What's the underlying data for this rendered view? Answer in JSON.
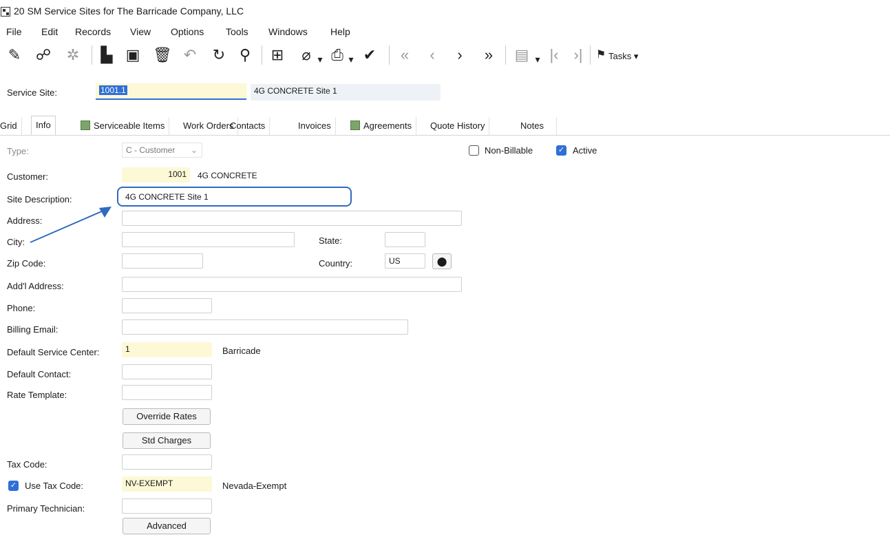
{
  "window": {
    "title": "20 SM Service Sites for The Barricade Company, LLC"
  },
  "menu": [
    "File",
    "Edit",
    "Records",
    "View",
    "Options",
    "Tools",
    "Windows",
    "Help"
  ],
  "toolbar": {
    "tasks_label": "Tasks ▾"
  },
  "header": {
    "service_site_label": "Service Site:",
    "service_site_value": "1001.1",
    "service_site_desc": "4G CONCRETE Site 1"
  },
  "tabs": [
    "Grid",
    "Info",
    "Serviceable Items",
    "Work Orders",
    "Contacts",
    "Invoices",
    "Agreements",
    "Quote History",
    "Notes"
  ],
  "form": {
    "type_label": "Type:",
    "type_value": "C - Customer",
    "non_billable_label": "Non-Billable",
    "active_label": "Active",
    "customer_label": "Customer:",
    "customer_value": "1001",
    "customer_name": "4G CONCRETE",
    "site_description_label": "Site Description:",
    "site_description_value": "4G CONCRETE Site 1",
    "address_label": "Address:",
    "address_value": "",
    "city_label": "City:",
    "city_value": "",
    "state_label": "State:",
    "state_value": "",
    "zip_label": "Zip Code:",
    "zip_value": "",
    "country_label": "Country:",
    "country_value": "US",
    "addl_address_label": "Add'l Address:",
    "addl_address_value": "",
    "phone_label": "Phone:",
    "phone_value": "",
    "billing_email_label": "Billing Email:",
    "billing_email_value": "",
    "default_service_center_label": "Default Service Center:",
    "default_service_center_value": "1",
    "default_service_center_name": "Barricade",
    "default_contact_label": "Default Contact:",
    "default_contact_value": "",
    "rate_template_label": "Rate Template:",
    "rate_template_value": "",
    "override_rates_button": "Override Rates",
    "std_charges_button": "Std Charges",
    "tax_code_label": "Tax Code:",
    "tax_code_value": "",
    "use_tax_code_label": "Use Tax Code:",
    "use_tax_code_value": "NV-EXEMPT",
    "use_tax_code_name": "Nevada-Exempt",
    "primary_technician_label": "Primary Technician:",
    "primary_technician_value": "",
    "advanced_button": "Advanced"
  },
  "colors": {
    "accent": "#2f6fd6",
    "highlight": "#2e6bc0",
    "required_field": "#fdf8d6"
  }
}
